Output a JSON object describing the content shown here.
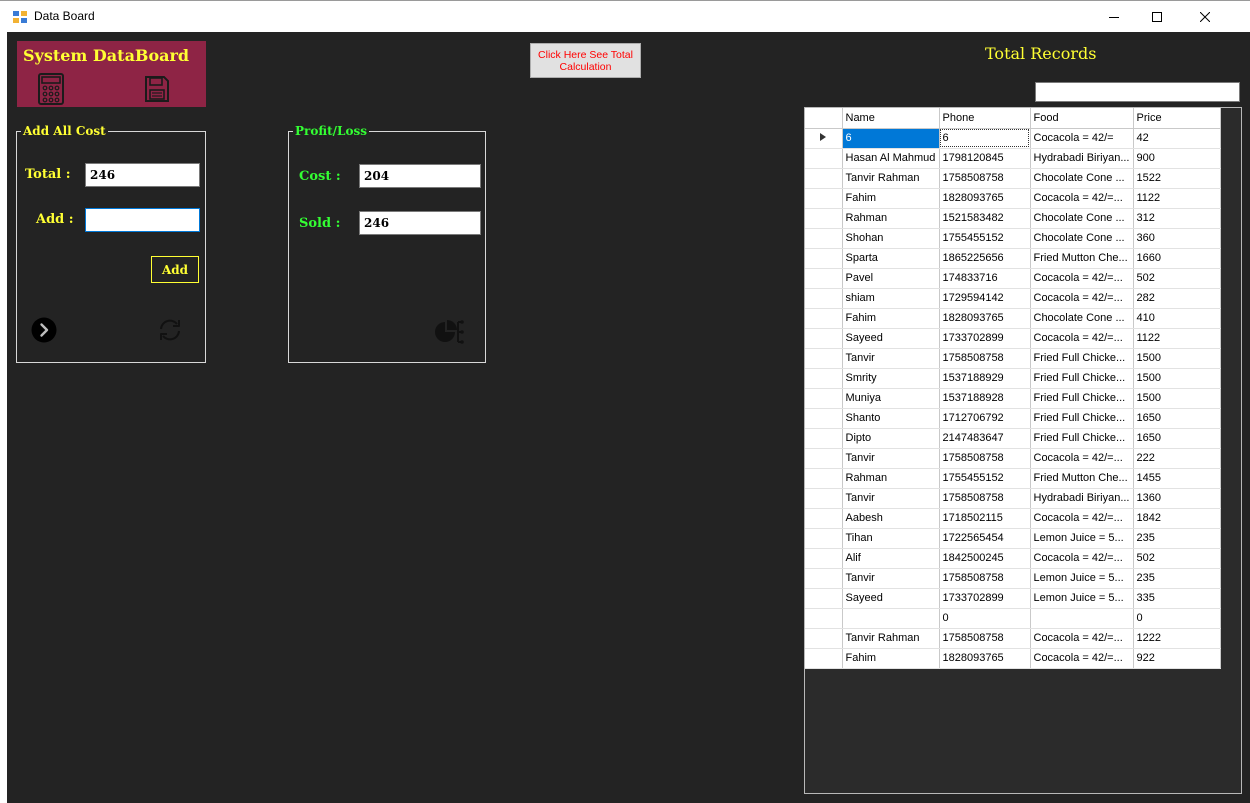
{
  "window": {
    "title": "Data Board"
  },
  "banner": {
    "title": "System DataBoard"
  },
  "add_cost": {
    "caption": "Add All Cost",
    "total_label": "Total :",
    "total_value": "246",
    "add_label": "Add :",
    "add_value": "",
    "add_button": "Add"
  },
  "profit_loss": {
    "caption": "Profit/Loss",
    "cost_label": "Cost :",
    "cost_value": "204",
    "sold_label": "Sold :",
    "sold_value": "246"
  },
  "calc_button": "Click Here See Total Calculation",
  "records": {
    "title": "Total Records",
    "search_value": "",
    "columns": [
      "Name",
      "Phone",
      "Food",
      "Price"
    ],
    "selected_row": 0,
    "rows": [
      [
        "6",
        "6",
        "Cocacola = 42/=",
        "42"
      ],
      [
        "Hasan Al Mahmud",
        "1798120845",
        "Hydrabadi Biriyan...",
        "900"
      ],
      [
        "Tanvir Rahman",
        "1758508758",
        "Chocolate Cone ...",
        "1522"
      ],
      [
        "Fahim",
        "1828093765",
        "Cocacola = 42/=...",
        "1122"
      ],
      [
        "Rahman",
        "1521583482",
        "Chocolate Cone ...",
        "312"
      ],
      [
        "Shohan",
        "1755455152",
        "Chocolate Cone ...",
        "360"
      ],
      [
        "Sparta",
        "1865225656",
        "Fried Mutton Che...",
        "1660"
      ],
      [
        "Pavel",
        "174833716",
        "Cocacola = 42/=...",
        "502"
      ],
      [
        "shiam",
        "1729594142",
        "Cocacola = 42/=...",
        "282"
      ],
      [
        "Fahim",
        "1828093765",
        "Chocolate Cone ...",
        "410"
      ],
      [
        "Sayeed",
        "1733702899",
        "Cocacola = 42/=...",
        "1122"
      ],
      [
        "Tanvir",
        "1758508758",
        "Fried Full Chicke...",
        "1500"
      ],
      [
        "Smrity",
        "1537188929",
        "Fried Full Chicke...",
        "1500"
      ],
      [
        "Muniya",
        "1537188928",
        "Fried Full Chicke...",
        "1500"
      ],
      [
        "Shanto",
        "1712706792",
        "Fried Full Chicke...",
        "1650"
      ],
      [
        "Dipto",
        "2147483647",
        "Fried Full Chicke...",
        "1650"
      ],
      [
        "Tanvir",
        "1758508758",
        "Cocacola = 42/=...",
        "222"
      ],
      [
        "Rahman",
        "1755455152",
        "Fried Mutton Che...",
        "1455"
      ],
      [
        "Tanvir",
        "1758508758",
        "Hydrabadi Biriyan...",
        "1360"
      ],
      [
        "Aabesh",
        "1718502115",
        "Cocacola = 42/=...",
        "1842"
      ],
      [
        "Tihan",
        "1722565454",
        "Lemon Juice = 5...",
        "235"
      ],
      [
        "Alif",
        "1842500245",
        "Cocacola = 42/=...",
        "502"
      ],
      [
        "Tanvir",
        "1758508758",
        "Lemon Juice = 5...",
        "235"
      ],
      [
        "Sayeed",
        "1733702899",
        "Lemon Juice = 5...",
        "335"
      ],
      [
        "",
        "0",
        "",
        "0"
      ],
      [
        "Tanvir Rahman",
        "1758508758",
        "Cocacola = 42/=...",
        "1222"
      ],
      [
        "Fahim",
        "1828093765",
        "Cocacola = 42/=...",
        "922"
      ]
    ]
  },
  "colors": {
    "background": "#232323",
    "banner": "#8e2445",
    "accent_yellow": "#ffff33",
    "accent_green": "#33ff33",
    "button_text_red": "#ff0000"
  }
}
